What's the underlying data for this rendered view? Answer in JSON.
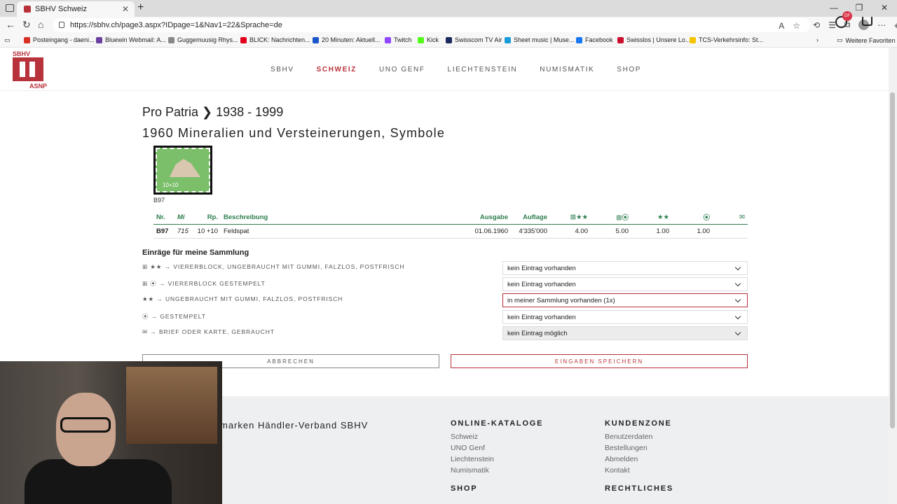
{
  "browser": {
    "tab_title": "SBHV Schweiz",
    "url": "https://sbhv.ch/page3.aspx?IDpage=1&Nav1=22&Sprache=de",
    "bookmarks": [
      {
        "label": "Posteingang - daeni...",
        "color": "#d93025"
      },
      {
        "label": "Bluewin Webmail: A...",
        "color": "#6b3fa0"
      },
      {
        "label": "Guggemuusig Rhys...",
        "color": "#888888"
      },
      {
        "label": "BLICK: Nachrichten...",
        "color": "#e2001a"
      },
      {
        "label": "20 Minuten: Aktuell...",
        "color": "#1a56c9"
      },
      {
        "label": "Twitch",
        "color": "#9146ff"
      },
      {
        "label": "Kick",
        "color": "#53fc18"
      },
      {
        "label": "Swisscom TV Air",
        "color": "#1b2a5c"
      },
      {
        "label": "Sheet music | Muse...",
        "color": "#1a9bd7"
      },
      {
        "label": "Facebook",
        "color": "#1877f2"
      },
      {
        "label": "Swisslos | Unsere Lo...",
        "color": "#c8102e"
      },
      {
        "label": "TCS-Verkehrsinfo: St...",
        "color": "#f5c400"
      }
    ],
    "more_favorites": "Weitere Favoriten"
  },
  "site": {
    "logo_top": "SBHV",
    "logo_bottom": "ASNP",
    "nav": [
      "SBHV",
      "SCHWEIZ",
      "UNO GENF",
      "LIECHTENSTEIN",
      "NUMISMATIK",
      "SHOP"
    ],
    "active_nav": "SCHWEIZ",
    "user_badge": "DF",
    "accent": "#b8323b",
    "green": "#2e7d4f"
  },
  "content": {
    "breadcrumb": "Pro Patria ❯ 1938 - 1999",
    "title": "1960 Mineralien und Versteinerungen, Symbole",
    "stamp_denomination": "10+10",
    "stamp_code": "B97",
    "table": {
      "headers": [
        "Nr.",
        "Mi",
        "Rp.",
        "Beschreibung",
        "Ausgabe",
        "Auflage",
        "⊞★★",
        "⊞⦿",
        "★★",
        "⦿",
        "✉"
      ],
      "rows": [
        [
          "B97",
          "715",
          "10 +10",
          "Feldspat",
          "01.06.1960",
          "4'335'000",
          "4.00",
          "5.00",
          "1.00",
          "1.00",
          ""
        ]
      ]
    },
    "section_title": "Einräge für meine Sammlung",
    "entries": [
      {
        "label": "⊞ ★★ → VIERERBLOCK, UNGEBRAUCHT MIT GUMMI, FALZLOS, POSTFRISCH",
        "value": "kein Eintrag vorhanden"
      },
      {
        "label": "⊞ ⦿ → VIERERBLOCK GESTEMPELT",
        "value": "kein Eintrag vorhanden"
      },
      {
        "label": "★★ → UNGEBRAUCHT MIT GUMMI, FALZLOS, POSTFRISCH",
        "value": "in meiner Sammlung vorhanden (1x)"
      },
      {
        "label": "⦿ → GESTEMPELT",
        "value": "kein Eintrag vorhanden"
      },
      {
        "label": "✉ → BRIEF ODER KARTE, GEBRAUCHT",
        "value": "kein Eintrag möglich"
      }
    ],
    "cancel_label": "ABBRECHEN",
    "save_label": "EINGABEN SPEICHERN"
  },
  "footer": {
    "org_title": "marken Händler-Verband SBHV",
    "col1_title": "ONLINE-KATALOGE",
    "col1_links": [
      "Schweiz",
      "UNO Genf",
      "Liechtenstein",
      "Numismatik"
    ],
    "col1b_title": "SHOP",
    "col2_title": "KUNDENZONE",
    "col2_links": [
      "Benutzerdaten",
      "Bestellungen",
      "Abmelden",
      "Kontakt"
    ],
    "col2b_title": "RECHTLICHES"
  }
}
